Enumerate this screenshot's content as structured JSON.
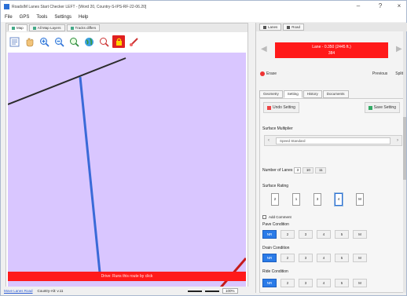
{
  "window": {
    "title": "RoadsIM Lanes Start Checker LEFT - [Word 20, Country-S-IPS-RF-22-06.20]",
    "min": "–",
    "help": "?",
    "close": "×"
  },
  "menu": [
    "File",
    "GPS",
    "Tools",
    "Settings",
    "Help"
  ],
  "left_tabs": [
    "Map",
    "All Map Layers",
    "Tracks differs"
  ],
  "toolbar_icons": [
    "Pan",
    "Zoom in",
    "Zoom out",
    "Zoom to extents",
    "Globe",
    "Select",
    "Lock",
    "Measure"
  ],
  "map": {
    "status_text": "Drive: Runs this route by click"
  },
  "right_tabs": [
    "Lanes",
    "Road"
  ],
  "readout": {
    "line1": "Lane - 0.350 (2445 ft.)",
    "line2": "384"
  },
  "buttons": {
    "erase": "Erase",
    "previous": "Previous",
    "next": "Split"
  },
  "sub_tabs": [
    "Geometry",
    "Setting",
    "History",
    "Documents"
  ],
  "panel": {
    "undo_setting": "Undo Setting",
    "save_setting": "Save Setting",
    "surface_multiplier_label": "Surface Multiplier",
    "surface_value": "Speed Standard",
    "lanes_label": "Number of Lanes",
    "lanes_value": "3",
    "lanes_mini": "10",
    "lanes_mini2": "11",
    "surface_rating_label": "Surface Rating",
    "ratings": [
      "2",
      "1",
      "3",
      "4",
      "M"
    ],
    "add_comment": "Add Comment",
    "rows": [
      {
        "label": "Pave Condition",
        "values": [
          "NR",
          "2",
          "3",
          "4",
          "5",
          "M"
        ],
        "selected": 0
      },
      {
        "label": "Drain Condition",
        "values": [
          "NR",
          "2",
          "3",
          "4",
          "5",
          "M"
        ],
        "selected": 0
      },
      {
        "label": "Ride Condition",
        "values": [
          "NR",
          "2",
          "3",
          "4",
          "5",
          "M"
        ],
        "selected": 0
      }
    ]
  },
  "statusbar": {
    "link": "Move Lanes Road",
    "coords": "Country-Alt: v.11",
    "zoom": "100%"
  }
}
